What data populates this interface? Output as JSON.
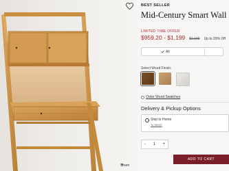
{
  "product": {
    "badge": "BEST SELLER",
    "title": "Mid-Century Smart Wall De",
    "promo_label": "LIMITED TIME OFFER",
    "price": "$959.20 - $1,199",
    "was_price": "$1,199",
    "discount": "Up to 20% Off",
    "size_option": "All",
    "finish_label": "Select Wood Finish:",
    "finishes": [
      "Walnut",
      "Acorn",
      "White"
    ],
    "swatch_link": "Order Wood Swatches",
    "delivery_title": "Delivery & Pickup Options",
    "ship_label": "Ship to Home",
    "ship_zip": "To 98102",
    "quantity": "1",
    "qty_minus": "-",
    "qty_plus": "+",
    "add_to_cart": "ADD TO CART",
    "share_label": "Share"
  },
  "colors": {
    "sale_red": "#b0262f",
    "cart_button": "#7a1f29",
    "wood": "#c9923f"
  }
}
